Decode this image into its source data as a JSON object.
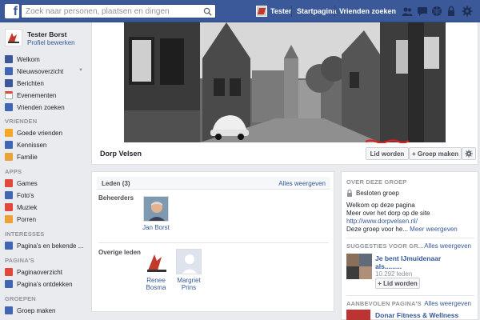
{
  "topbar": {
    "logo": "f",
    "search_placeholder": "Zoek naar personen, plaatsen en dingen",
    "user_name": "Tester",
    "links": [
      "Startpagina",
      "Vrienden zoeken"
    ],
    "icons": [
      "friend-requests-icon",
      "messages-icon",
      "notifications-icon",
      "privacy-lock-icon",
      "settings-icon"
    ]
  },
  "sidebar": {
    "profile_name": "Tester Borst",
    "profile_edit": "Profiel bewerken",
    "favorites": [
      {
        "label": "Welkom",
        "icon": "welcome-icon",
        "color": "#3b5998"
      },
      {
        "label": "Nieuwsoverzicht",
        "icon": "newsfeed-icon",
        "color": "#4267b2"
      },
      {
        "label": "Berichten",
        "icon": "messages-icon",
        "color": "#3b5998"
      },
      {
        "label": "Evenementen",
        "icon": "events-icon",
        "color": "#e0e0e0"
      },
      {
        "label": "Vrienden zoeken",
        "icon": "find-friends-icon",
        "color": "#4267b2"
      }
    ],
    "sections": {
      "vrienden": "VRIENDEN",
      "apps": "APPS",
      "interesses": "INTERESSES",
      "paginas": "PAGINA'S",
      "groepen": "GROEPEN"
    },
    "friends": [
      {
        "label": "Goede vrienden",
        "icon": "star-icon",
        "color": "#f5a623"
      },
      {
        "label": "Kennissen",
        "icon": "acquaintances-icon",
        "color": "#4267b2"
      },
      {
        "label": "Familie",
        "icon": "family-icon",
        "color": "#e8a33a"
      }
    ],
    "apps": [
      {
        "label": "Games",
        "icon": "games-icon",
        "color": "#e0483e"
      },
      {
        "label": "Foto's",
        "icon": "photos-icon",
        "color": "#4267b2"
      },
      {
        "label": "Muziek",
        "icon": "music-icon",
        "color": "#e0483e"
      },
      {
        "label": "Porren",
        "icon": "poke-icon",
        "color": "#f0a030"
      }
    ],
    "interests": [
      {
        "label": "Pagina's en bekende ...",
        "icon": "pages-feed-icon",
        "color": "#4267b2"
      }
    ],
    "pages": [
      {
        "label": "Paginaoverzicht",
        "icon": "pages-overview-icon",
        "color": "#e0483e"
      },
      {
        "label": "Pagina's ontdekken",
        "icon": "discover-pages-icon",
        "color": "#4267b2"
      }
    ],
    "groups": [
      {
        "label": "Groep maken",
        "icon": "create-group-icon",
        "color": "#4267b2"
      }
    ]
  },
  "group": {
    "title": "Dorp Velsen",
    "join_button": "Lid worden",
    "create_group_button": "+ Groep maken",
    "settings_icon": "gear-icon"
  },
  "members": {
    "title": "Leden (3)",
    "see_all": "Alles weergeven",
    "admins_label": "Beheerders",
    "others_label": "Overige leden",
    "admins": [
      {
        "name": "Jan Borst"
      }
    ],
    "others": [
      {
        "name": "Renee Bosma"
      },
      {
        "name": "Margriet Prins"
      }
    ]
  },
  "about": {
    "heading": "OVER DEZE GROEP",
    "privacy": "Besloten groep",
    "line1": "Welkom op deze pagina",
    "line2": "Meer over het dorp op de site",
    "url": "http://www.dorpvelsen.nl/",
    "line3_prefix": "Deze groep voor he...",
    "see_more": "Meer weergeven"
  },
  "suggestions": {
    "heading": "SUGGESTIES VOOR GR...",
    "see_all": "Alles weergeven",
    "title_line1": "Je bent IJmuidenaar",
    "title_line2": "als.........",
    "count": "10.292 leden",
    "join": "+ Lid worden"
  },
  "recommended": {
    "heading": "AANBEVOLEN PAGINA'S",
    "see_all": "Alles weergeven",
    "page_title": "Donar Fitness & Wellness"
  }
}
